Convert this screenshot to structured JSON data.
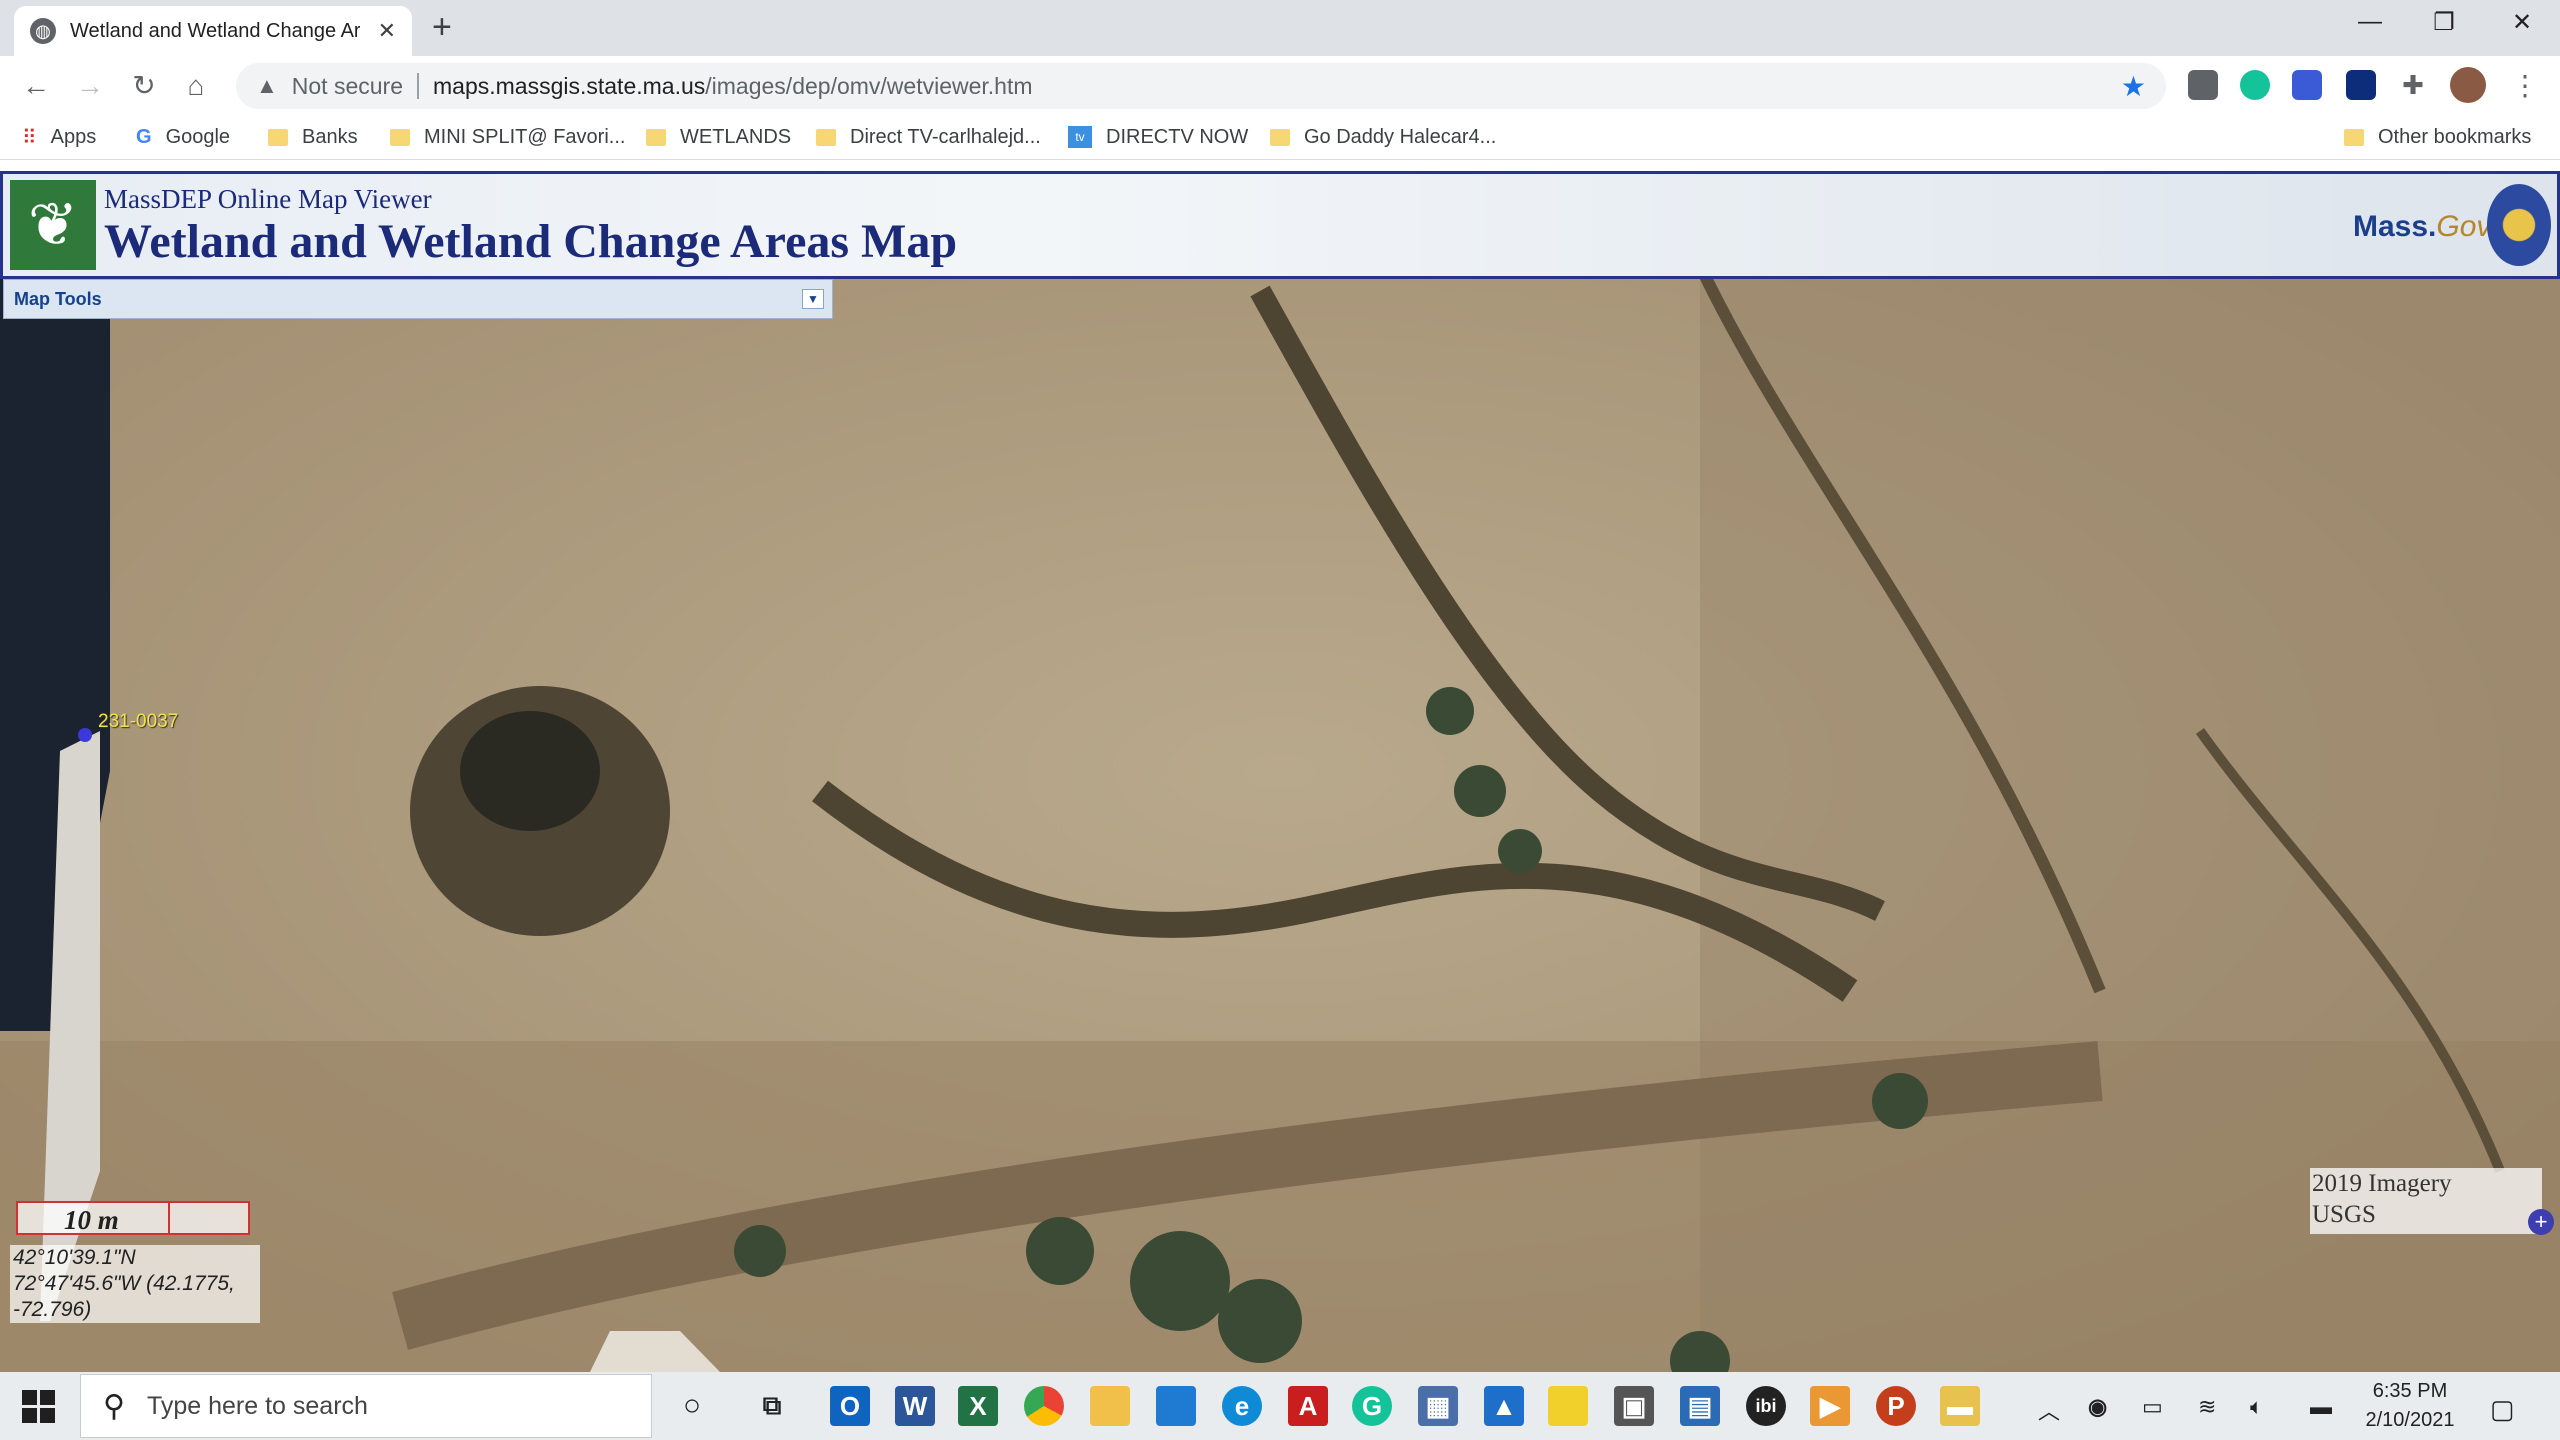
{
  "browser": {
    "tab_title": "Wetland and Wetland Change Ar",
    "url_security": "Not secure",
    "url_host": "maps.massgis.state.ma.us",
    "url_path": "/images/dep/omv/wetviewer.htm"
  },
  "bookmarks": [
    {
      "label": "Apps",
      "icon": "apps-grid-icon"
    },
    {
      "label": "Google",
      "icon": "google-icon"
    },
    {
      "label": "Banks",
      "icon": "folder-icon"
    },
    {
      "label": "MINI SPLIT@ Favori...",
      "icon": "folder-icon"
    },
    {
      "label": "WETLANDS",
      "icon": "folder-icon"
    },
    {
      "label": "Direct TV-carlhalejd...",
      "icon": "folder-icon"
    },
    {
      "label": "DIRECTV NOW",
      "icon": "tv-icon"
    },
    {
      "label": "Go Daddy Halecar4...",
      "icon": "folder-icon"
    },
    {
      "label": "Other bookmarks",
      "icon": "folder-icon"
    }
  ],
  "page": {
    "subtitle": "MassDEP Online Map Viewer",
    "title": "Wetland and Wetland Change Areas Map",
    "massgov_a": "Mass.",
    "massgov_b": "Gov",
    "map_tools": "Map Tools",
    "parcel_label": "231-0037",
    "scale_label": "10 m",
    "coords_line1": "42°10'39.1\"N",
    "coords_line2": "72°47'45.6\"W (42.1775,",
    "coords_line3": "-72.796)",
    "attribution_line1": "2019 Imagery",
    "attribution_line2": "USGS"
  },
  "taskbar": {
    "search_placeholder": "Type here to search",
    "time": "6:35 PM",
    "date": "2/10/2021"
  },
  "colors": {
    "banner_blue": "#1c2a7a",
    "chrome_bg": "#dee1e6",
    "link_blue": "#1a73e8",
    "map_tools_bg": "#dce6f2"
  }
}
